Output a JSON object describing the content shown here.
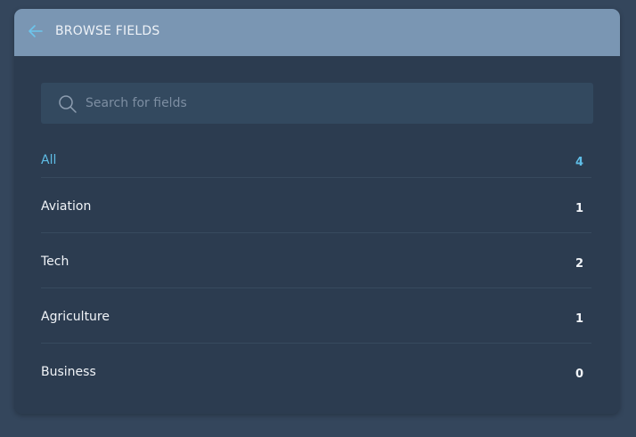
{
  "header": {
    "title": "BROWSE FIELDS",
    "back_icon": "arrow-left-icon"
  },
  "search": {
    "placeholder": "Search for fields",
    "value": "",
    "icon": "search-icon"
  },
  "fields": [
    {
      "label": "All",
      "count": "4",
      "active": true
    },
    {
      "label": "Aviation",
      "count": "1",
      "active": false
    },
    {
      "label": "Tech",
      "count": "2",
      "active": false
    },
    {
      "label": "Agriculture",
      "count": "1",
      "active": false
    },
    {
      "label": "Business",
      "count": "0",
      "active": false
    }
  ],
  "colors": {
    "background": "#34465c",
    "panel": "#2c3c50",
    "header": "#7a96b3",
    "accent": "#5fbde6",
    "text": "#f1f4f8"
  }
}
